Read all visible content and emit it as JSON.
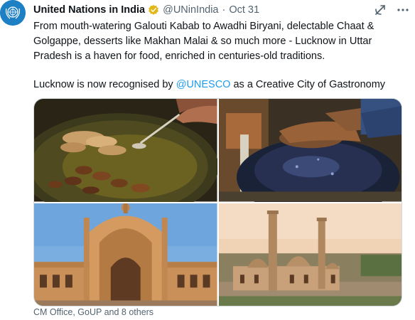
{
  "tweet": {
    "author": {
      "name": "United Nations in India",
      "handle": "@UNinIndia",
      "avatar_icon": "un-emblem-icon",
      "verified_icon": "verified-badge-icon"
    },
    "separator": "·",
    "date": "Oct 31",
    "text_line1": "From mouth-watering Galouti Kabab to Awadhi Biryani, delectable Chaat & Golgappe, desserts like Makhan Malai & so much more - Lucknow in Uttar Pradesh is a haven for food, enriched in centuries-old traditions.",
    "text_line2_before": "Lucknow is now recognised by ",
    "text_line2_mention": "@UNESCO",
    "text_line2_after": " as a Creative City of Gastronomy",
    "footer": "CM Office, GoUP and 8 others"
  },
  "actions": {
    "grok_icon": "grok-icon",
    "more_icon": "more-horizontal-icon"
  },
  "colors": {
    "link": "#1d9bf0",
    "secondary_text": "#536471",
    "verified_badge": "#e2b719",
    "avatar_bg": "#1d7fc4"
  }
}
